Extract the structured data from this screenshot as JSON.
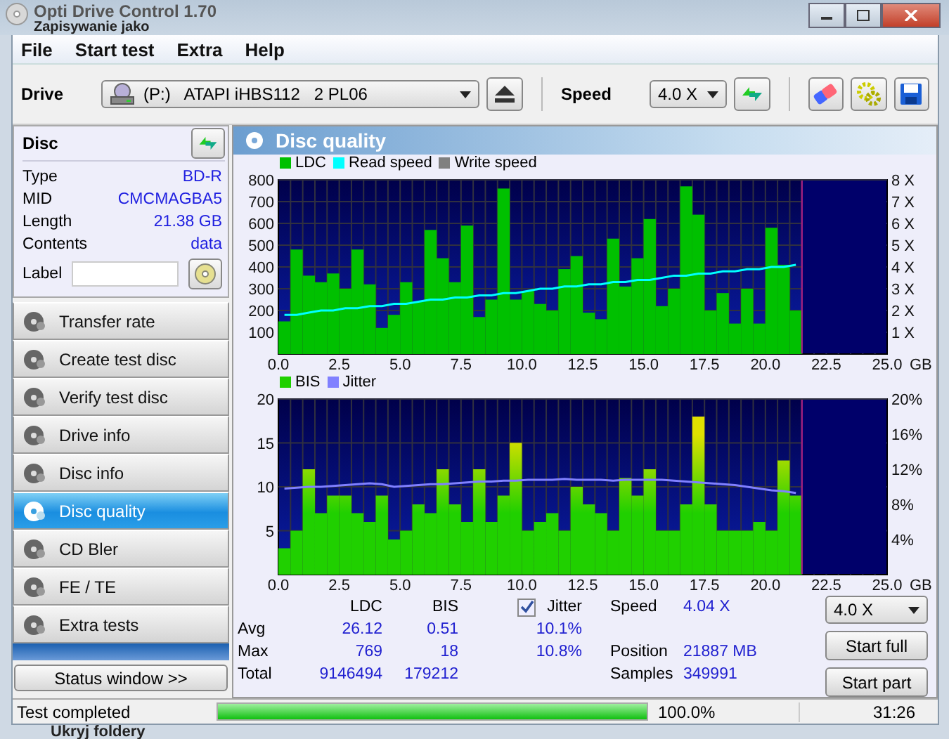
{
  "window": {
    "title": "Opti Drive Control 1.70"
  },
  "background_window": {
    "title": "Zapisywanie jako",
    "item": "Ukryj foldery"
  },
  "menu": [
    "File",
    "Start test",
    "Extra",
    "Help"
  ],
  "toolbar": {
    "drive_label": "Drive",
    "drive": "(P:)   ATAPI iHBS112   2 PL06",
    "speed_label": "Speed",
    "speed": "4.0 X"
  },
  "disc": {
    "title": "Disc",
    "fields": [
      {
        "label": "Type",
        "value": "BD-R"
      },
      {
        "label": "MID",
        "value": "CMCMAGBA5"
      },
      {
        "label": "Length",
        "value": "21.38 GB"
      },
      {
        "label": "Contents",
        "value": "data"
      }
    ],
    "label_field": {
      "label": "Label"
    }
  },
  "nav": [
    {
      "label": "Transfer rate",
      "selected": false
    },
    {
      "label": "Create test disc",
      "selected": false
    },
    {
      "label": "Verify test disc",
      "selected": false
    },
    {
      "label": "Drive info",
      "selected": false
    },
    {
      "label": "Disc info",
      "selected": false
    },
    {
      "label": "Disc quality",
      "selected": true
    },
    {
      "label": "CD Bler",
      "selected": false
    },
    {
      "label": "FE / TE",
      "selected": false
    },
    {
      "label": "Extra tests",
      "selected": false
    }
  ],
  "status_button": "Status window >>",
  "panel": {
    "title": "Disc quality",
    "charts": [
      {
        "legend_extra": [
          {
            "label": "Write speed",
            "color": "#808080"
          }
        ],
        "chart_data": {
          "type": "bar",
          "grid": true,
          "xlabel": "GB",
          "x": [
            0.25,
            0.75,
            1.25,
            1.75,
            2.25,
            2.75,
            3.25,
            3.75,
            4.25,
            4.75,
            5.25,
            5.75,
            6.25,
            6.75,
            7.25,
            7.75,
            8.25,
            8.75,
            9.25,
            9.75,
            10.25,
            10.75,
            11.25,
            11.75,
            12.25,
            12.75,
            13.25,
            13.75,
            14.25,
            14.75,
            15.25,
            15.75,
            16.25,
            16.75,
            17.25,
            17.75,
            18.25,
            18.75,
            19.25,
            19.75,
            20.25,
            20.75,
            21.25
          ],
          "series": [
            {
              "name": "LDC",
              "color": "#00c000",
              "values": [
                150,
                480,
                360,
                330,
                370,
                300,
                480,
                320,
                120,
                180,
                330,
                240,
                570,
                440,
                330,
                590,
                170,
                250,
                760,
                250,
                290,
                230,
                200,
                390,
                450,
                190,
                160,
                530,
                310,
                440,
                620,
                220,
                300,
                770,
                640,
                200,
                280,
                140,
                300,
                140,
                580,
                410,
                200
              ]
            },
            {
              "name": "Read speed",
              "type": "line",
              "axis": "y2",
              "color": "#00ffff",
              "values": [
                1.8,
                1.8,
                1.9,
                2.0,
                2.0,
                2.1,
                2.1,
                2.2,
                2.2,
                2.3,
                2.3,
                2.4,
                2.5,
                2.5,
                2.6,
                2.6,
                2.7,
                2.7,
                2.8,
                2.8,
                2.9,
                3.0,
                3.0,
                3.1,
                3.1,
                3.2,
                3.2,
                3.3,
                3.3,
                3.4,
                3.4,
                3.5,
                3.6,
                3.6,
                3.7,
                3.7,
                3.8,
                3.8,
                3.9,
                3.9,
                4.0,
                4.0,
                4.1
              ]
            }
          ],
          "xlim": [
            0,
            25
          ],
          "ylim": [
            0,
            800
          ],
          "y2lim": [
            0,
            8
          ],
          "xticks": [
            {
              "value": 0,
              "label": "0.0"
            },
            {
              "value": 2.5,
              "label": "2.5"
            },
            {
              "value": 5,
              "label": "5.0"
            },
            {
              "value": 7.5,
              "label": "7.5"
            },
            {
              "value": 10,
              "label": "10.0"
            },
            {
              "value": 12.5,
              "label": "12.5"
            },
            {
              "value": 15,
              "label": "15.0"
            },
            {
              "value": 17.5,
              "label": "17.5"
            },
            {
              "value": 20,
              "label": "20.0"
            },
            {
              "value": 22.5,
              "label": "22.5"
            },
            {
              "value": 25,
              "label": "25.0"
            }
          ],
          "yticks": [
            100,
            200,
            300,
            400,
            500,
            600,
            700,
            800
          ],
          "y2ticks": [
            {
              "value": 1,
              "label": "1 X"
            },
            {
              "value": 2,
              "label": "2 X"
            },
            {
              "value": 3,
              "label": "3 X"
            },
            {
              "value": 4,
              "label": "4 X"
            },
            {
              "value": 5,
              "label": "5 X"
            },
            {
              "value": 6,
              "label": "6 X"
            },
            {
              "value": 7,
              "label": "7 X"
            },
            {
              "value": 8,
              "label": "8 X"
            }
          ],
          "bands": [
            {
              "axis": "x",
              "from": 21.5,
              "to": 25,
              "color": "#00006a"
            }
          ],
          "ref_lines": [
            {
              "axis": "x",
              "value": 21.5,
              "color": "#a02080"
            }
          ]
        }
      },
      {
        "chart_data": {
          "type": "bar",
          "grid": true,
          "xlabel": "GB",
          "x": [
            0.25,
            0.75,
            1.25,
            1.75,
            2.25,
            2.75,
            3.25,
            3.75,
            4.25,
            4.75,
            5.25,
            5.75,
            6.25,
            6.75,
            7.25,
            7.75,
            8.25,
            8.75,
            9.25,
            9.75,
            10.25,
            10.75,
            11.25,
            11.75,
            12.25,
            12.75,
            13.25,
            13.75,
            14.25,
            14.75,
            15.25,
            15.75,
            16.25,
            16.75,
            17.25,
            17.75,
            18.25,
            18.75,
            19.25,
            19.75,
            20.25,
            20.75,
            21.25
          ],
          "series": [
            {
              "name": "BIS",
              "color": "#20d000",
              "values": [
                3,
                5,
                12,
                7,
                9,
                9,
                7,
                6,
                9,
                4,
                5,
                8,
                7,
                12,
                8,
                6,
                12,
                6,
                9,
                15,
                5,
                6,
                7,
                5,
                10,
                8,
                7,
                5,
                11,
                9,
                12,
                5,
                5,
                8,
                18,
                8,
                5,
                5,
                5,
                6,
                5,
                13,
                9
              ]
            },
            {
              "name": "Jitter",
              "type": "line",
              "axis": "y2",
              "color": "#8080ff",
              "values": [
                9.8,
                9.9,
                10.0,
                10.0,
                10.1,
                10.2,
                10.3,
                10.4,
                10.3,
                10.0,
                10.1,
                10.2,
                10.3,
                10.3,
                10.4,
                10.5,
                10.6,
                10.6,
                10.7,
                10.7,
                10.8,
                10.8,
                10.8,
                10.9,
                10.8,
                10.8,
                10.8,
                10.7,
                10.8,
                10.8,
                10.8,
                10.8,
                10.7,
                10.6,
                10.5,
                10.4,
                10.3,
                10.2,
                10.0,
                9.8,
                9.6,
                9.5,
                9.3
              ]
            }
          ],
          "xlim": [
            0,
            25
          ],
          "ylim": [
            0,
            20
          ],
          "y2lim": [
            0,
            20
          ],
          "xticks": [
            {
              "value": 0,
              "label": "0.0"
            },
            {
              "value": 2.5,
              "label": "2.5"
            },
            {
              "value": 5,
              "label": "5.0"
            },
            {
              "value": 7.5,
              "label": "7.5"
            },
            {
              "value": 10,
              "label": "10.0"
            },
            {
              "value": 12.5,
              "label": "12.5"
            },
            {
              "value": 15,
              "label": "15.0"
            },
            {
              "value": 17.5,
              "label": "17.5"
            },
            {
              "value": 20,
              "label": "20.0"
            },
            {
              "value": 22.5,
              "label": "22.5"
            },
            {
              "value": 25,
              "label": "25.0"
            }
          ],
          "yticks": [
            5,
            10,
            15,
            20
          ],
          "y2ticks": [
            {
              "value": 4,
              "label": "4%"
            },
            {
              "value": 8,
              "label": "8%"
            },
            {
              "value": 12,
              "label": "12%"
            },
            {
              "value": 16,
              "label": "16%"
            },
            {
              "value": 20,
              "label": "20%"
            }
          ],
          "bands": [
            {
              "axis": "x",
              "from": 21.5,
              "to": 25,
              "color": "#00006a"
            }
          ],
          "ref_lines": [
            {
              "axis": "x",
              "value": 21.5,
              "color": "#a02080"
            }
          ]
        }
      }
    ]
  },
  "stats": {
    "columns": [
      "LDC",
      "BIS"
    ],
    "jitter": {
      "label": "Jitter",
      "checked": true
    },
    "rows": [
      {
        "label": "Avg",
        "ldc": "26.12",
        "bis": "0.51",
        "jitter": "10.1%"
      },
      {
        "label": "Max",
        "ldc": "769",
        "bis": "18",
        "jitter": "10.8%"
      },
      {
        "label": "Total",
        "ldc": "9146494",
        "bis": "179212"
      }
    ],
    "info": [
      {
        "label": "Speed",
        "value": "4.04 X"
      },
      {
        "label": "Position",
        "value": "21887 MB"
      },
      {
        "label": "Samples",
        "value": "349991"
      }
    ],
    "speed_select": "4.0 X",
    "buttons": [
      "Start full",
      "Start part"
    ]
  },
  "status_bar": {
    "text": "Test completed",
    "level": 1.0,
    "percent": "100.0%",
    "time": "31:26"
  }
}
